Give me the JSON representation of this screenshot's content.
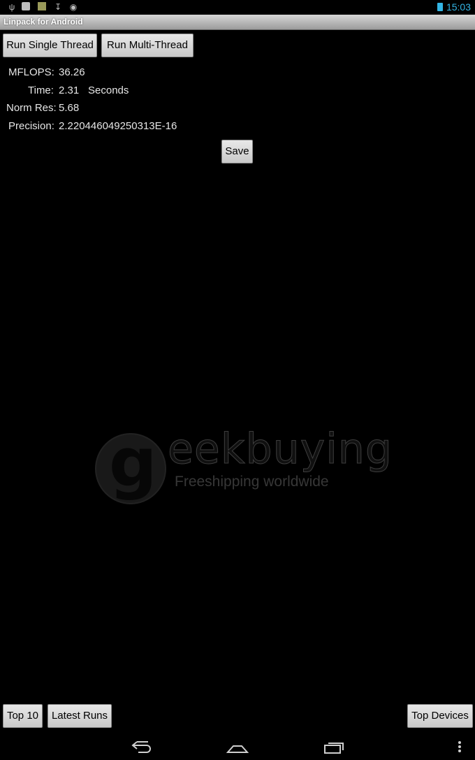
{
  "status_bar": {
    "time": "15:03",
    "icons": [
      "usb-icon",
      "notification-icon",
      "package-icon",
      "download-icon",
      "android-icon",
      "battery-icon"
    ]
  },
  "app": {
    "title": "Linpack for Android"
  },
  "buttons": {
    "run_single": "Run Single Thread",
    "run_multi": "Run Multi-Thread",
    "save": "Save",
    "top10": "Top 10",
    "latest_runs": "Latest Runs",
    "top_devices": "Top Devices"
  },
  "results": {
    "mflops_label": "MFLOPS:",
    "mflops_value": "36.26",
    "time_label": "Time:",
    "time_value": "2.31",
    "time_unit": "Seconds",
    "normres_label": "Norm Res:",
    "normres_value": "5.68",
    "precision_label": "Precision:",
    "precision_value": "2.220446049250313E-16"
  },
  "watermark": {
    "brand": "eekbuying",
    "brand_initial": "g",
    "tagline": "Freeshipping worldwide"
  },
  "nav_bar": {
    "icons": [
      "back-icon",
      "home-icon",
      "recents-icon",
      "menu-icon"
    ]
  }
}
